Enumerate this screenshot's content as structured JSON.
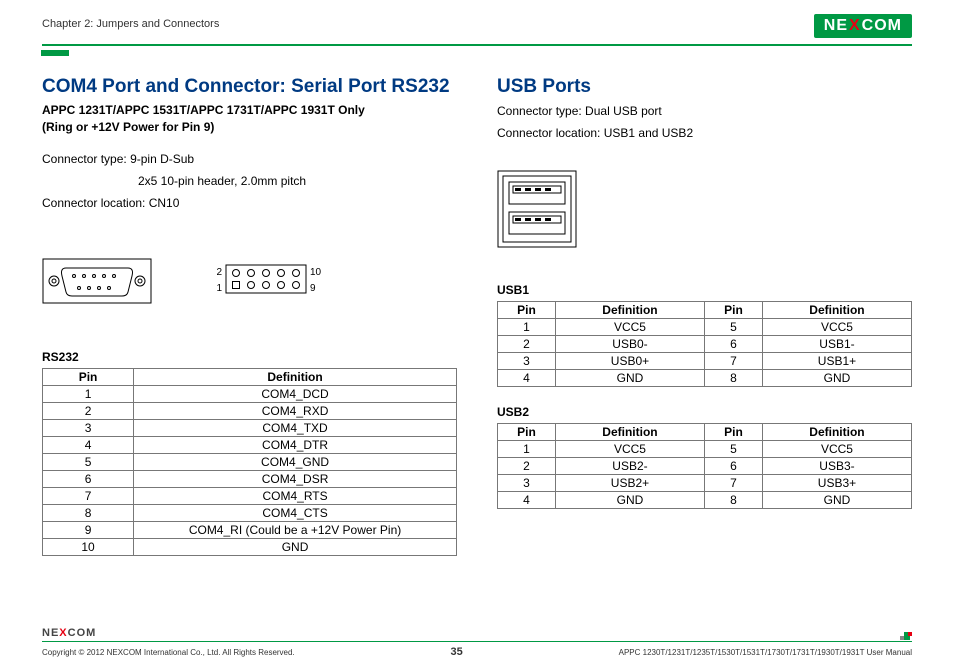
{
  "header": {
    "chapter": "Chapter 2: Jumpers and Connectors",
    "logo_text_left": "NE",
    "logo_text_x": "X",
    "logo_text_right": "COM"
  },
  "left": {
    "title": "COM4 Port and Connector: Serial Port RS232",
    "subtitle_line1": "APPC 1231T/APPC 1531T/APPC 1731T/APPC 1931T Only",
    "subtitle_line2": "(Ring or +12V Power for Pin 9)",
    "conn_type_label": "Connector type: ",
    "conn_type_val1": "9-pin D-Sub",
    "conn_type_val2": "2x5 10-pin header, 2.0mm pitch",
    "conn_loc": "Connector location: CN10",
    "pin_header_labels": {
      "a": "2",
      "b": "10",
      "c": "1",
      "d": "9"
    },
    "table_label": "RS232",
    "th_pin": "Pin",
    "th_def": "Definition",
    "rows": [
      {
        "pin": "1",
        "def": "COM4_DCD"
      },
      {
        "pin": "2",
        "def": "COM4_RXD"
      },
      {
        "pin": "3",
        "def": "COM4_TXD"
      },
      {
        "pin": "4",
        "def": "COM4_DTR"
      },
      {
        "pin": "5",
        "def": "COM4_GND"
      },
      {
        "pin": "6",
        "def": "COM4_DSR"
      },
      {
        "pin": "7",
        "def": "COM4_RTS"
      },
      {
        "pin": "8",
        "def": "COM4_CTS"
      },
      {
        "pin": "9",
        "def": "COM4_RI (Could be a +12V Power Pin)"
      },
      {
        "pin": "10",
        "def": "GND"
      }
    ]
  },
  "right": {
    "title": "USB Ports",
    "line1": "Connector type: Dual USB port",
    "line2": "Connector location: USB1 and USB2",
    "usb1_label": "USB1",
    "usb2_label": "USB2",
    "th_pin": "Pin",
    "th_def": "Definition",
    "usb1_rows": [
      {
        "p1": "1",
        "d1": "VCC5",
        "p2": "5",
        "d2": "VCC5"
      },
      {
        "p1": "2",
        "d1": "USB0-",
        "p2": "6",
        "d2": "USB1-"
      },
      {
        "p1": "3",
        "d1": "USB0+",
        "p2": "7",
        "d2": "USB1+"
      },
      {
        "p1": "4",
        "d1": "GND",
        "p2": "8",
        "d2": "GND"
      }
    ],
    "usb2_rows": [
      {
        "p1": "1",
        "d1": "VCC5",
        "p2": "5",
        "d2": "VCC5"
      },
      {
        "p1": "2",
        "d1": "USB2-",
        "p2": "6",
        "d2": "USB3-"
      },
      {
        "p1": "3",
        "d1": "USB2+",
        "p2": "7",
        "d2": "USB3+"
      },
      {
        "p1": "4",
        "d1": "GND",
        "p2": "8",
        "d2": "GND"
      }
    ]
  },
  "footer": {
    "logo_left": "NE",
    "logo_x": "X",
    "logo_right": "COM",
    "copyright": "Copyright © 2012 NEXCOM International Co., Ltd. All Rights Reserved.",
    "page": "35",
    "manual": "APPC 1230T/1231T/1235T/1530T/1531T/1730T/1731T/1930T/1931T User Manual"
  }
}
